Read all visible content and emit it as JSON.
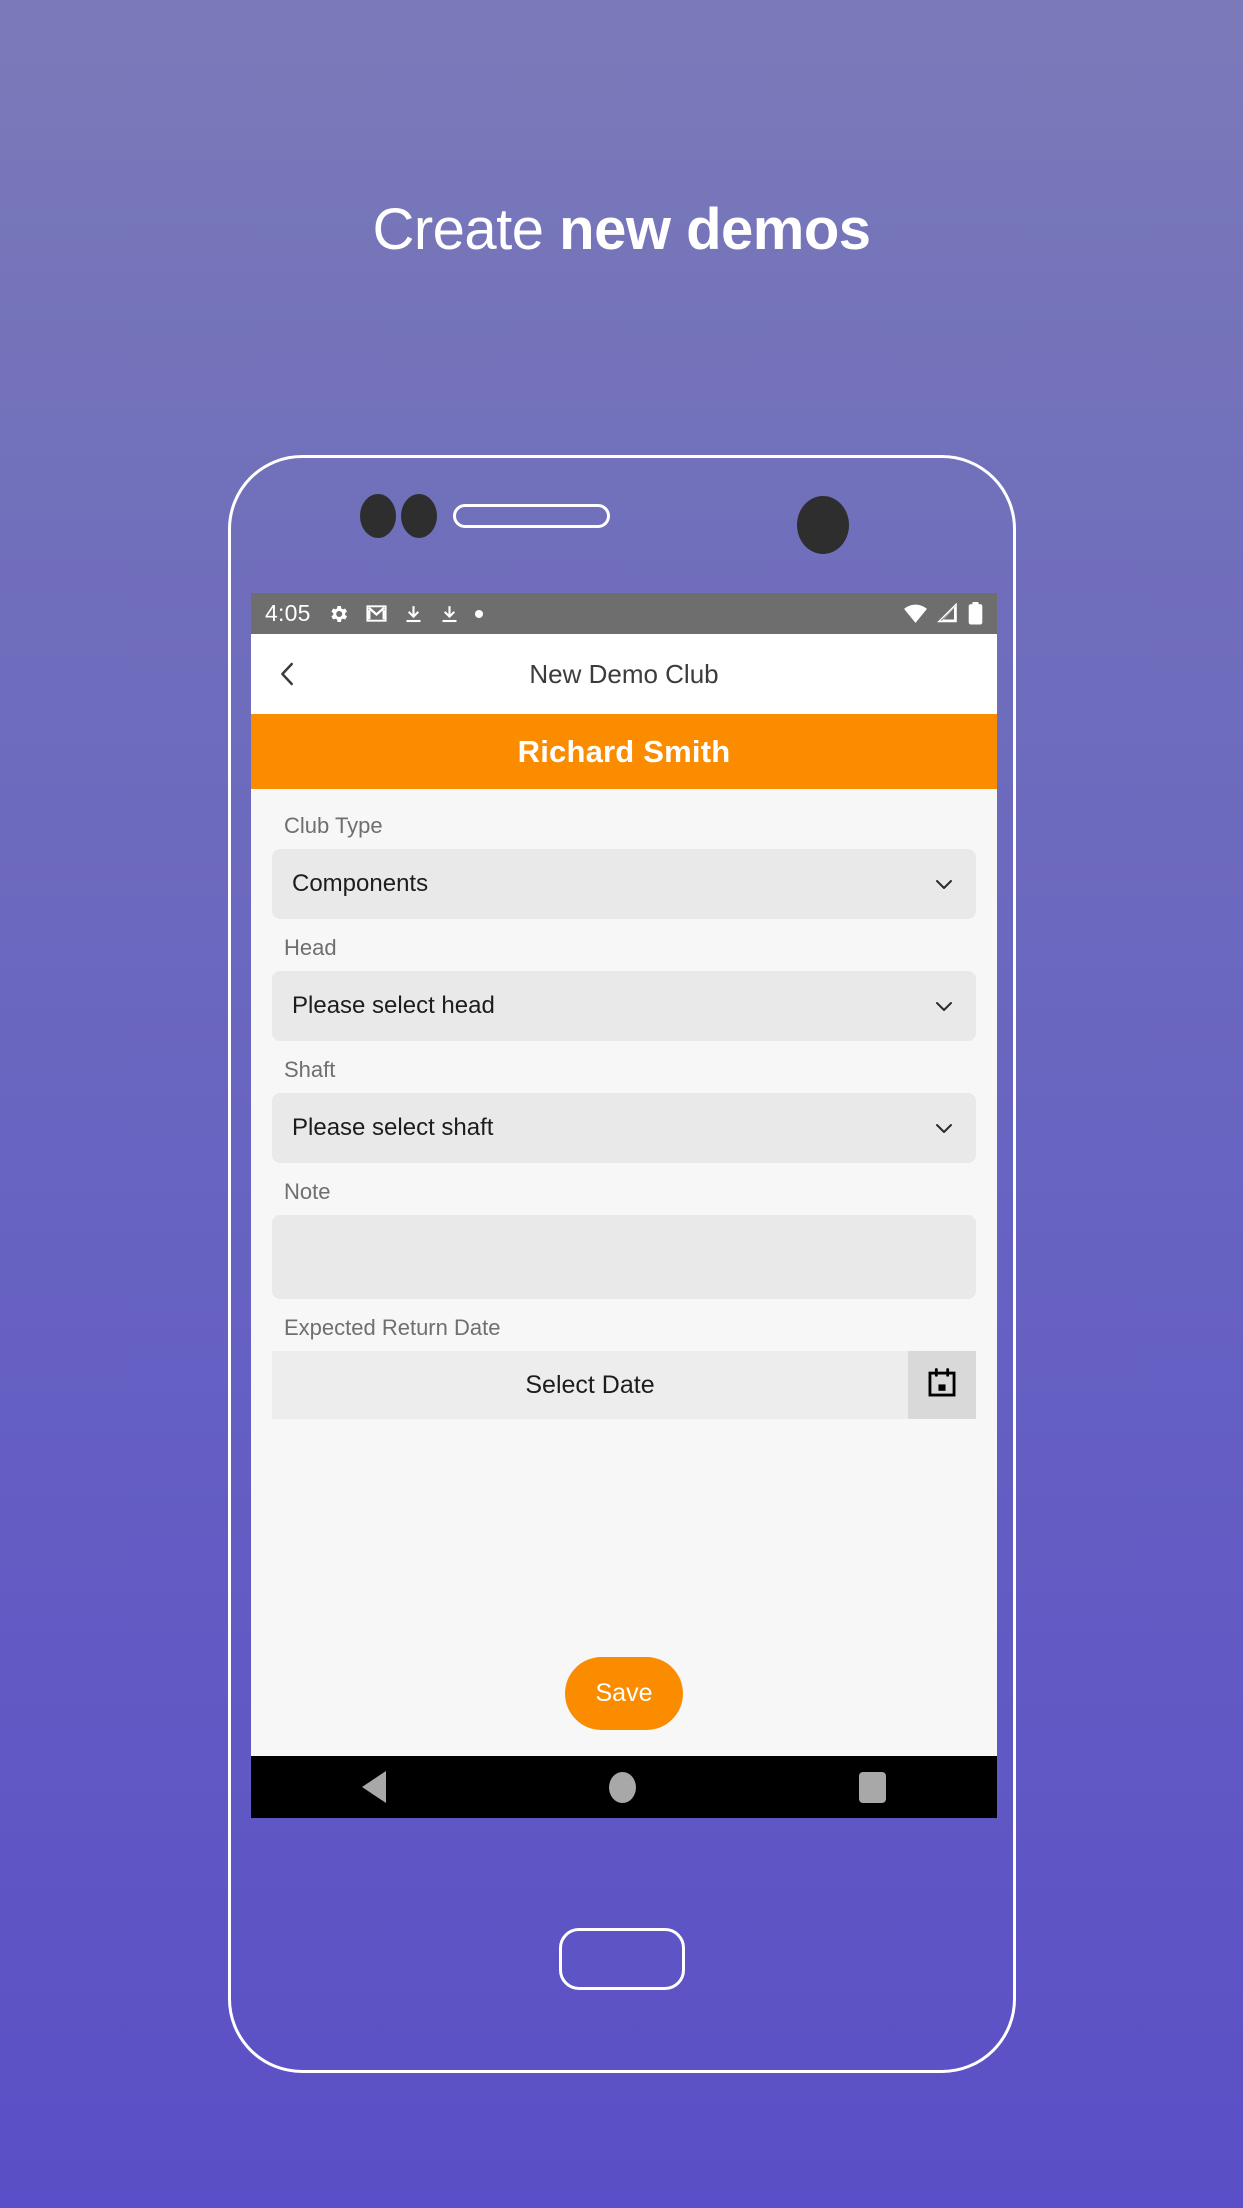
{
  "headline": {
    "light": "Create ",
    "bold": "new demos"
  },
  "phone": {
    "frame_color": "#ffffff",
    "background_gradient_top": "#7b7ab9",
    "background_gradient_bottom": "#5a4fc6"
  },
  "status_bar": {
    "time": "4:05",
    "left_icons": [
      "gear-icon",
      "gmail-icon",
      "download-icon",
      "download-icon",
      "dot-icon"
    ],
    "right_icons": [
      "wifi-icon",
      "cellular-signal-icon",
      "battery-icon"
    ],
    "background": "#6e6e6e"
  },
  "app_bar": {
    "back_icon": "back-chevron-icon",
    "title": "New Demo Club"
  },
  "banner": {
    "name": "Richard Smith",
    "color": "#fb8c00"
  },
  "form": {
    "fields": [
      {
        "label": "Club Type",
        "value": "Components",
        "type": "select",
        "icon": "chevron-down-icon"
      },
      {
        "label": "Head",
        "value": "Please select head",
        "type": "select",
        "icon": "chevron-down-icon"
      },
      {
        "label": "Shaft",
        "value": "Please select shaft",
        "type": "select",
        "icon": "chevron-down-icon"
      }
    ],
    "note": {
      "label": "Note",
      "value": "",
      "placeholder": ""
    },
    "date": {
      "label": "Expected Return Date",
      "value": "Select Date",
      "icon": "calendar-icon"
    }
  },
  "save_button": {
    "label": "Save",
    "color": "#fb8c00"
  },
  "nav_bar": {
    "items": [
      "back-triangle-icon",
      "home-circle-icon",
      "recents-square-icon"
    ],
    "background": "#000000"
  }
}
